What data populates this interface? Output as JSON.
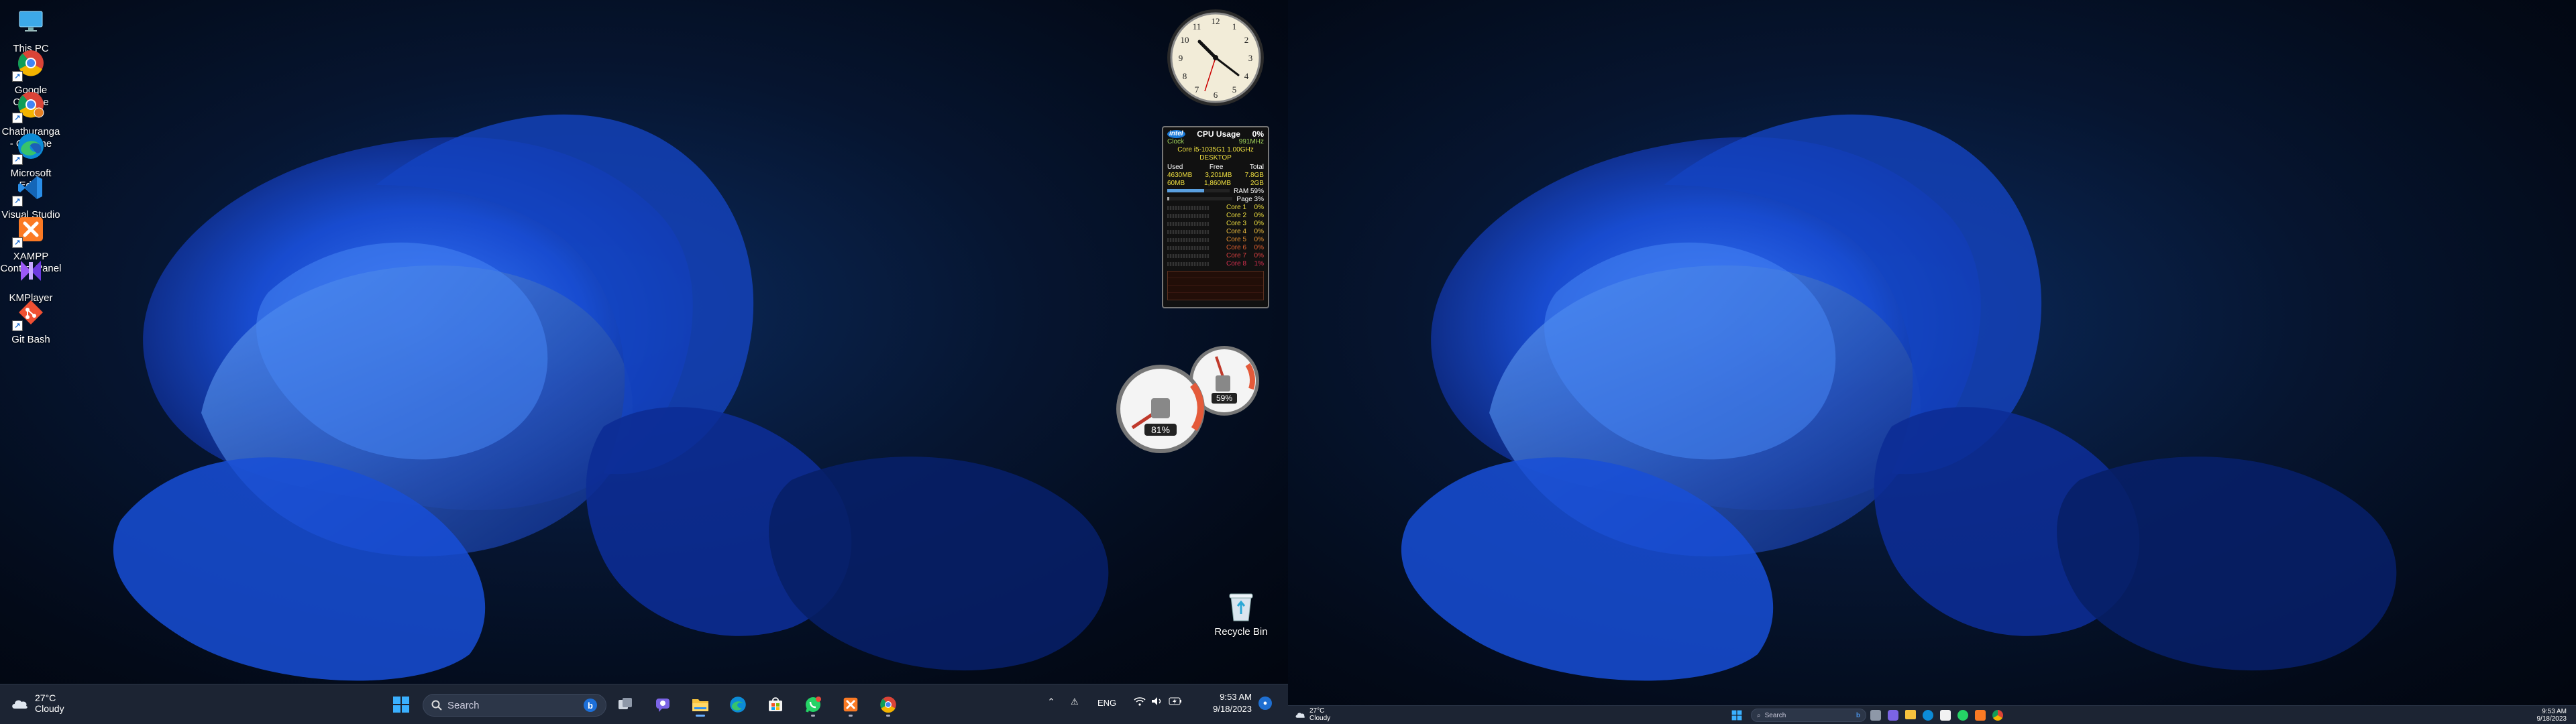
{
  "desktop_icons": [
    {
      "label": "This PC",
      "icon": "monitor-icon"
    },
    {
      "label": "Google\nChrome",
      "icon": "chrome-icon"
    },
    {
      "label": "Chathuranga\n- Chrome",
      "icon": "chrome-profile-icon"
    },
    {
      "label": "Microsoft\nEdge",
      "icon": "edge-icon"
    },
    {
      "label": "Visual Studio\nCode",
      "icon": "vscode-icon"
    },
    {
      "label": "XAMPP\nControl Panel",
      "icon": "xampp-icon"
    },
    {
      "label": "KMPlayer",
      "icon": "kmplayer-icon"
    },
    {
      "label": "Git Bash",
      "icon": "git-bash-icon"
    }
  ],
  "recycle_bin": {
    "label": "Recycle Bin"
  },
  "cpu_meter": {
    "brand": "intel",
    "title": "CPU Usage",
    "usage": "0%",
    "clock_label": "Clock",
    "clock_value": "991MHz",
    "cpu_name": "Core i5-1035G1 1.00GHz",
    "host": "DESKTOP",
    "mem_headers": [
      "Used",
      "Free",
      "Total"
    ],
    "ram_row": [
      "4630MB",
      "3,201MB",
      "7.8GB"
    ],
    "page_row": [
      "60MB",
      "1,860MB",
      "2GB"
    ],
    "ram_label": "RAM",
    "ram_pct": "59%",
    "ram_fraction": 0.59,
    "page_label": "Page",
    "page_pct": "3%",
    "cores": [
      {
        "name": "Core 1",
        "pct": "0%"
      },
      {
        "name": "Core 2",
        "pct": "0%"
      },
      {
        "name": "Core 3",
        "pct": "0%"
      },
      {
        "name": "Core 4",
        "pct": "0%"
      },
      {
        "name": "Core 5",
        "pct": "0%"
      },
      {
        "name": "Core 6",
        "pct": "0%"
      },
      {
        "name": "Core 7",
        "pct": "0%"
      },
      {
        "name": "Core 8",
        "pct": "1%"
      }
    ]
  },
  "gauges": {
    "cpu_pct": "81%",
    "mem_pct": "59%"
  },
  "taskbar_main": {
    "weather_temp": "27°C",
    "weather_cond": "Cloudy",
    "search_placeholder": "Search",
    "apps": [
      "start-icon",
      "task-view-icon",
      "chat-icon",
      "file-explorer-icon",
      "edge-icon",
      "whatsapp-icon",
      "xampp-icon",
      "chrome-icon"
    ],
    "tray_lang": "ENG",
    "time": "9:53 AM",
    "date": "9/18/2023"
  },
  "taskbar_second": {
    "weather_temp": "27°C",
    "weather_cond": "Cloudy",
    "search_placeholder": "Search",
    "time": "9:53 AM",
    "date": "9/18/2023"
  },
  "colors": {
    "taskbar": "#1c2433",
    "accent": "#1f6fd1",
    "wallpaper": "#0b2a5c"
  }
}
